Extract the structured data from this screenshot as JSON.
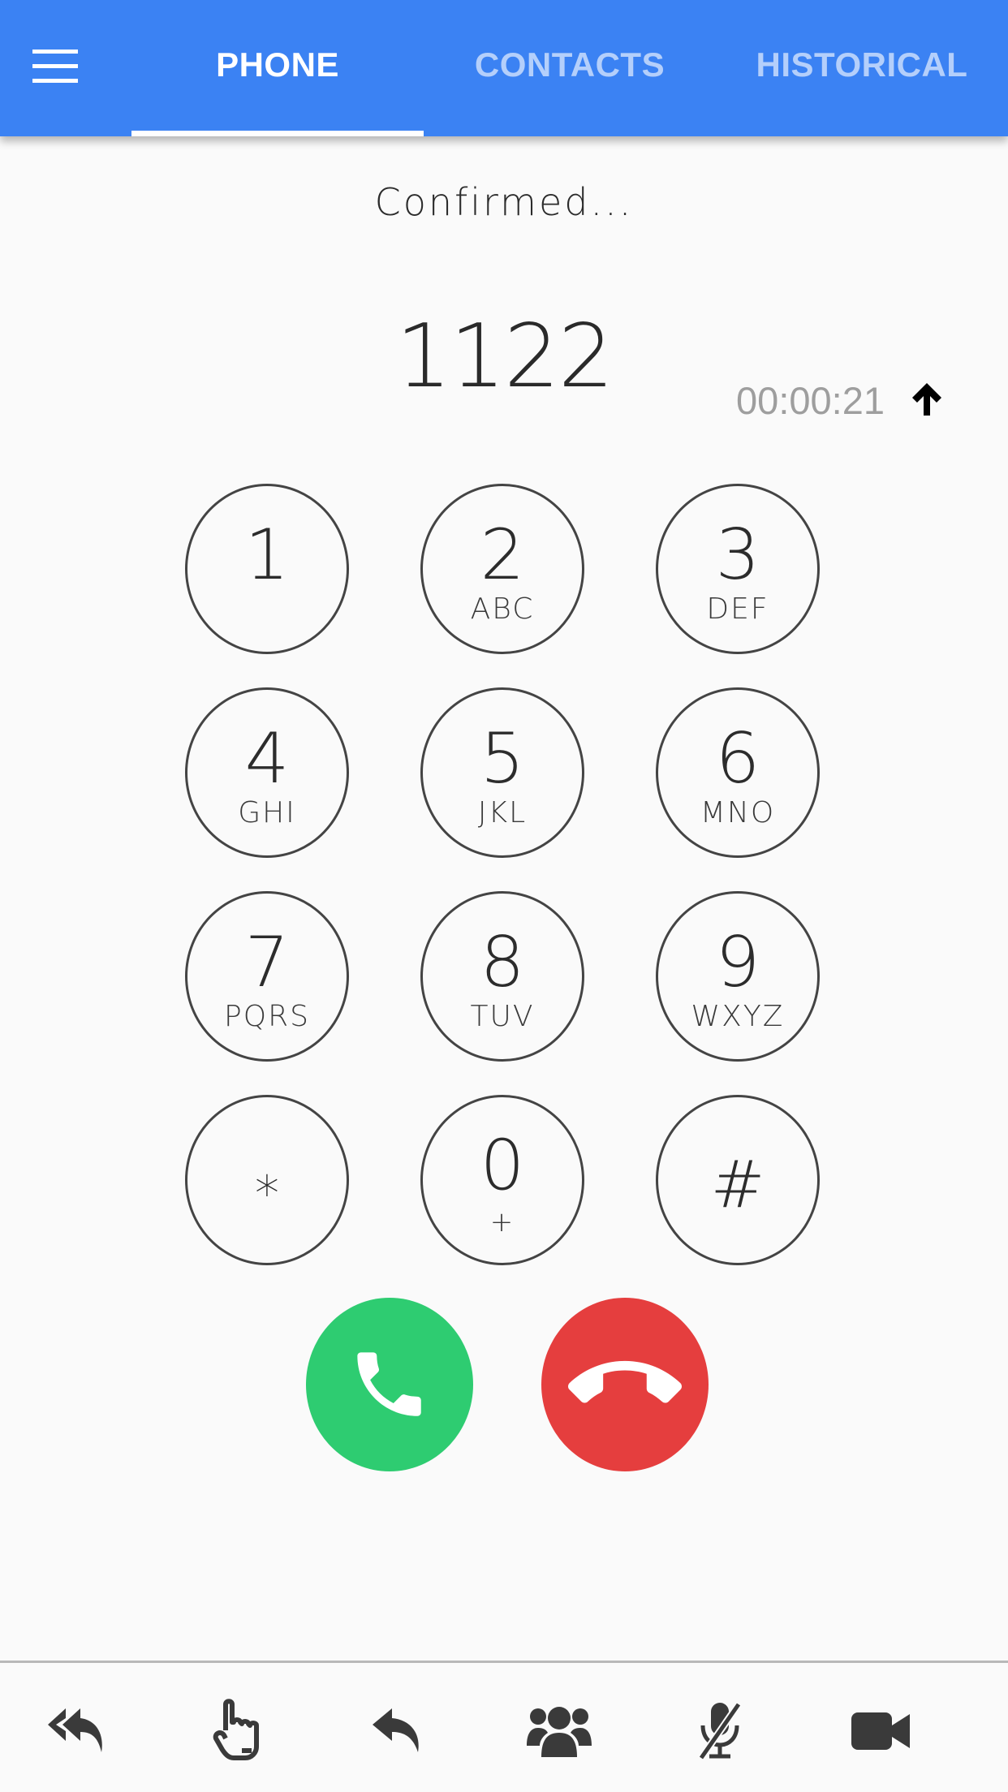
{
  "header": {
    "tabs": [
      {
        "label": "PHONE",
        "active": true
      },
      {
        "label": "CONTACTS",
        "active": false
      },
      {
        "label": "HISTORICAL",
        "active": false
      }
    ],
    "background_color": "#3b82f3"
  },
  "call": {
    "status": "Confirmed...",
    "number": "1122",
    "timer": "00:00:21",
    "direction_icon": "arrow-up-icon"
  },
  "keypad": [
    {
      "digit": "1",
      "letters": ""
    },
    {
      "digit": "2",
      "letters": "ABC"
    },
    {
      "digit": "3",
      "letters": "DEF"
    },
    {
      "digit": "4",
      "letters": "GHI"
    },
    {
      "digit": "5",
      "letters": "JKL"
    },
    {
      "digit": "6",
      "letters": "MNO"
    },
    {
      "digit": "7",
      "letters": "PQRS"
    },
    {
      "digit": "8",
      "letters": "TUV"
    },
    {
      "digit": "9",
      "letters": "WXYZ"
    },
    {
      "digit": "*",
      "letters": ""
    },
    {
      "digit": "0",
      "letters": "+"
    },
    {
      "digit": "#",
      "letters": ""
    }
  ],
  "call_buttons": {
    "accept": {
      "icon": "phone-icon",
      "color": "#2ecc71"
    },
    "hangup": {
      "icon": "phone-hangup-icon",
      "color": "#e53e3e"
    }
  },
  "toolbar": {
    "items": [
      {
        "icon": "reply-all-icon"
      },
      {
        "icon": "hand-pointer-icon"
      },
      {
        "icon": "reply-icon"
      },
      {
        "icon": "users-icon"
      },
      {
        "icon": "microphone-slash-icon"
      },
      {
        "icon": "video-camera-icon"
      }
    ]
  }
}
